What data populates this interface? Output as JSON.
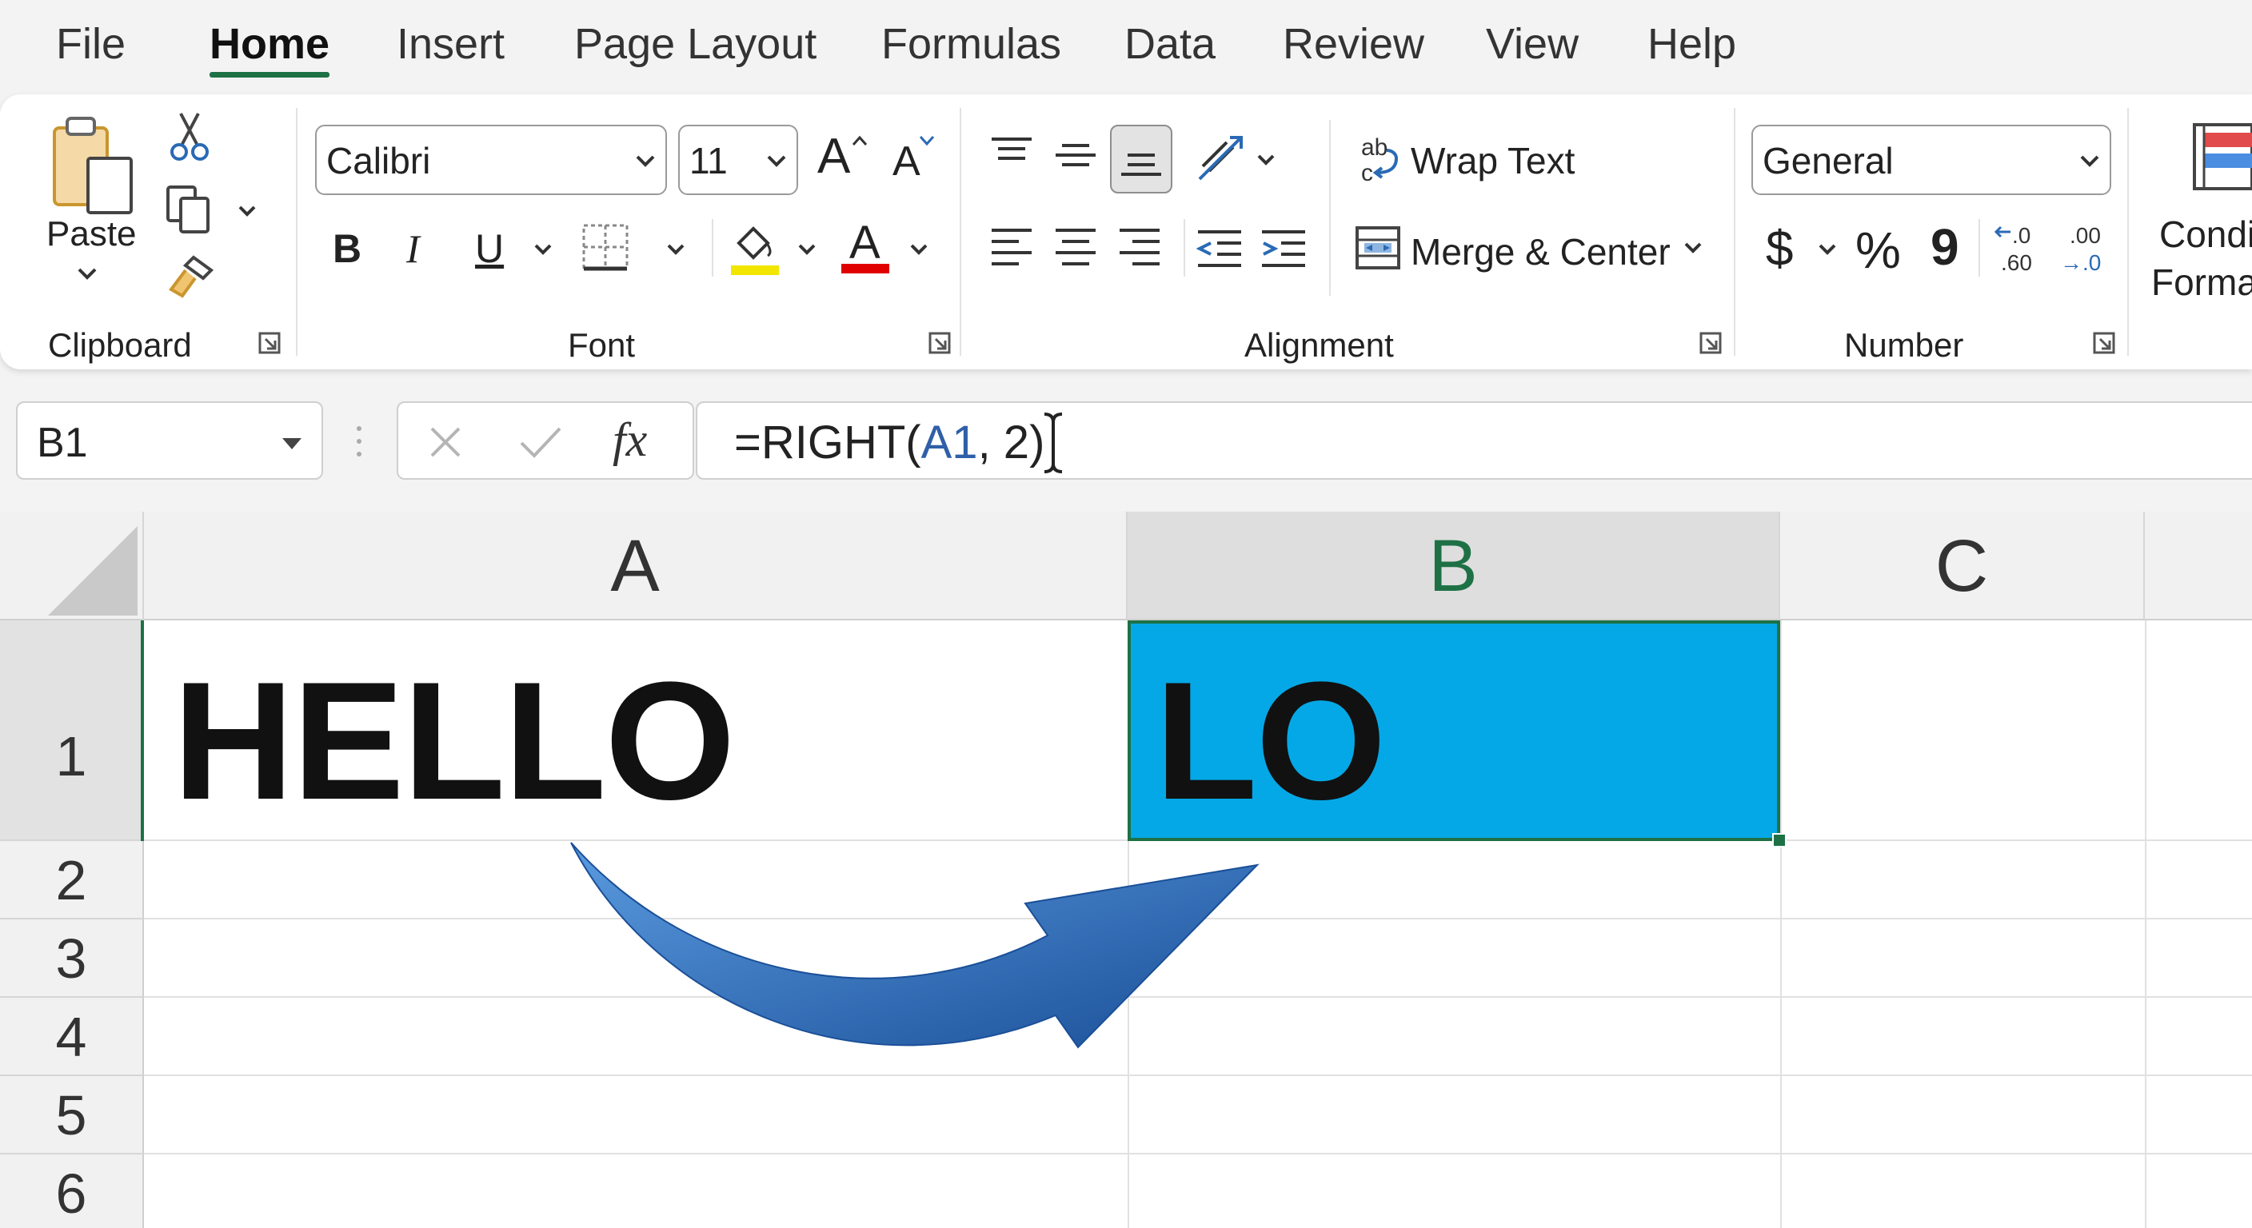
{
  "menu": {
    "tabs": [
      "File",
      "Home",
      "Insert",
      "Page Layout",
      "Formulas",
      "Data",
      "Review",
      "View",
      "Help"
    ],
    "active": "Home"
  },
  "ribbon": {
    "clipboard": {
      "label": "Clipboard",
      "paste": "Paste"
    },
    "font": {
      "label": "Font",
      "font_name": "Calibri",
      "font_size": "11",
      "bold": "B",
      "italic": "I",
      "underline": "U",
      "font_color_glyph": "A",
      "grow": "A",
      "shrink": "A",
      "highlight_color": "#f2e600",
      "text_color": "#e00000"
    },
    "alignment": {
      "label": "Alignment",
      "wrap_text": "Wrap Text",
      "merge_center": "Merge & Center",
      "wrap_glyph_top": "ab",
      "wrap_glyph_bottom": "c"
    },
    "number": {
      "label": "Number",
      "format": "General",
      "currency": "$",
      "percent": "%",
      "comma": "9",
      "inc_decimal_top": ".0",
      "inc_decimal_bottom": ".60",
      "dec_decimal_top": ".00",
      "dec_decimal_bottom": "→.0"
    },
    "styles": {
      "cond_line1": "Condi",
      "cond_line2": "Forma"
    }
  },
  "formula_bar": {
    "name_box": "B1",
    "fx": "fx",
    "formula_prefix": "=RIGHT(",
    "formula_ref": "A1",
    "formula_suffix": ", 2)"
  },
  "sheet": {
    "columns": [
      "A",
      "B",
      "C"
    ],
    "rows": [
      "1",
      "2",
      "3",
      "4",
      "5",
      "6"
    ],
    "selected_column": "B",
    "selected_row": "1",
    "cells": {
      "A1": "HELLO",
      "B1": "LO"
    },
    "selected_fill": "#05a8e6"
  }
}
